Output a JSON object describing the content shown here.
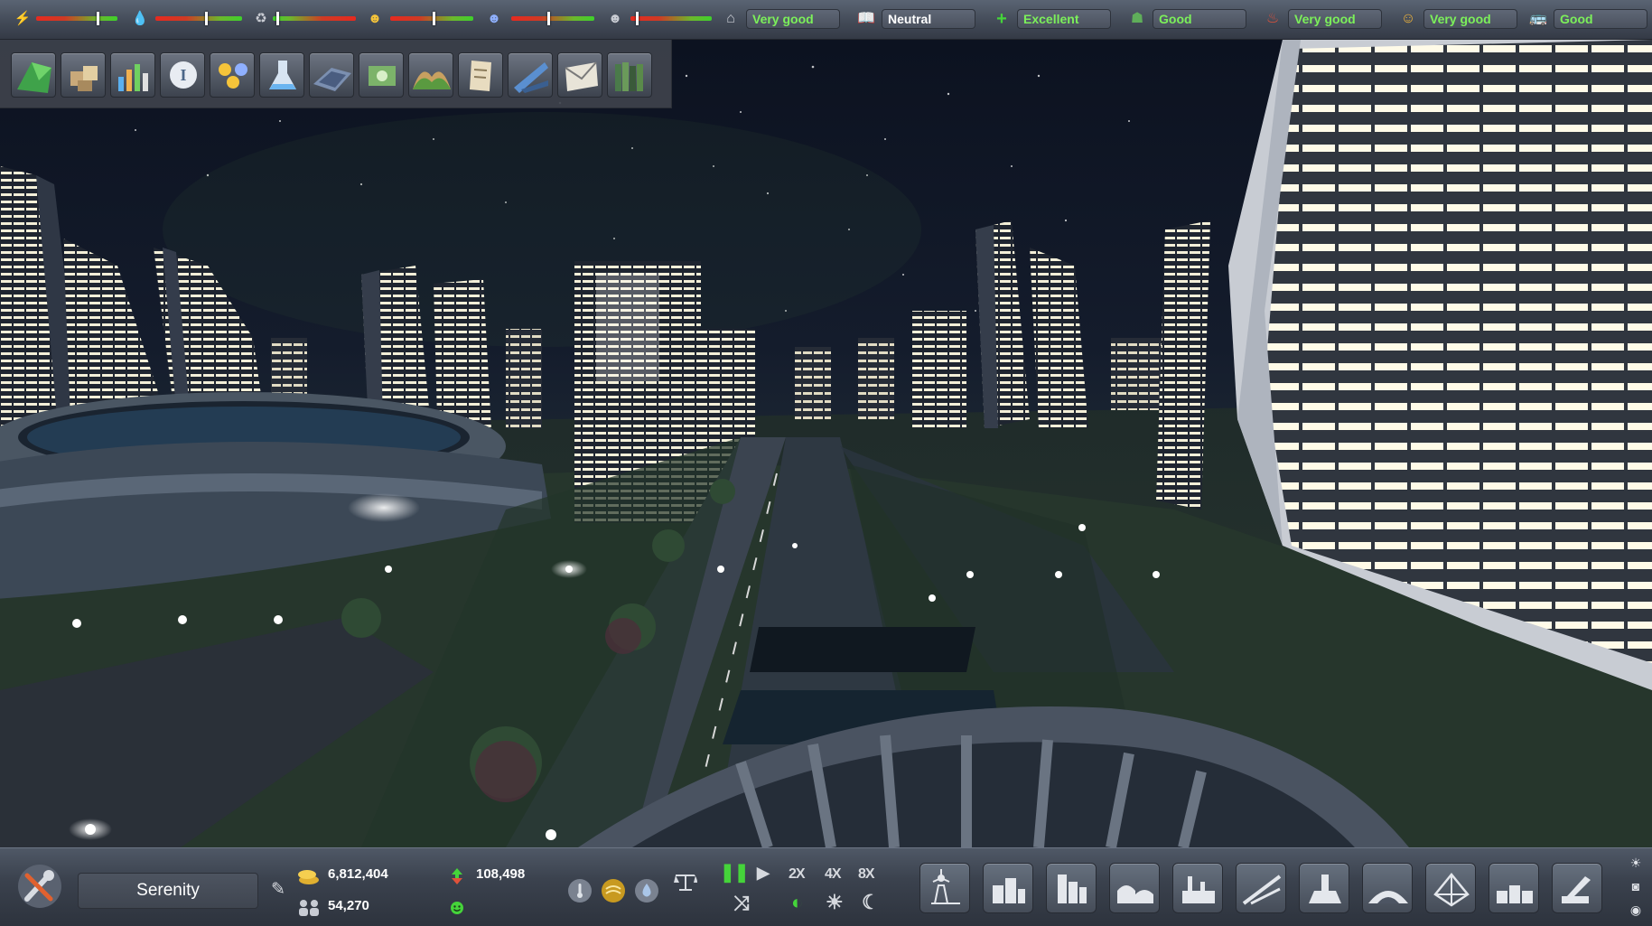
{
  "top_meters": [
    {
      "icon": "power-icon",
      "level": 0.75
    },
    {
      "icon": "water-icon",
      "level": 0.58
    },
    {
      "icon": "waste-icon",
      "level": 0.05
    },
    {
      "icon": "worker-icon",
      "level": 0.52
    },
    {
      "icon": "specialist-icon",
      "level": 0.45
    },
    {
      "icon": "engineer-icon",
      "level": 0.08
    }
  ],
  "ratings": {
    "housing": {
      "icon": "housing-icon",
      "value": "Very good"
    },
    "education": {
      "icon": "education-icon",
      "value": "Neutral"
    },
    "health": {
      "icon": "health-icon",
      "value": "Excellent"
    },
    "safety": {
      "icon": "safety-icon",
      "value": "Good"
    },
    "fire": {
      "icon": "fire-icon",
      "value": "Very good"
    },
    "leisure": {
      "icon": "leisure-icon",
      "value": "Very good"
    },
    "transport": {
      "icon": "transport-icon",
      "value": "Good"
    }
  },
  "category_toolbar": [
    {
      "icon": "map-overview-icon"
    },
    {
      "icon": "resources-icon"
    },
    {
      "icon": "statistics-icon"
    },
    {
      "icon": "info-icon"
    },
    {
      "icon": "population-icon"
    },
    {
      "icon": "research-icon"
    },
    {
      "icon": "projects-icon"
    },
    {
      "icon": "finance-icon"
    },
    {
      "icon": "environment-icon"
    },
    {
      "icon": "policies-icon"
    },
    {
      "icon": "trade-icon"
    },
    {
      "icon": "mail-icon"
    },
    {
      "icon": "library-icon"
    }
  ],
  "bottom": {
    "city_name": "Serenity",
    "money": "6,812,404",
    "population": "54,270",
    "income": "108,498",
    "speeds": {
      "x2": "2X",
      "x4": "4X",
      "x8": "8X"
    }
  },
  "build_menu": [
    {
      "icon": "power-build-icon"
    },
    {
      "icon": "residential-build-icon"
    },
    {
      "icon": "commercial-build-icon"
    },
    {
      "icon": "services-build-icon"
    },
    {
      "icon": "industry-build-icon"
    },
    {
      "icon": "transport-build-icon"
    },
    {
      "icon": "landmark-build-icon"
    },
    {
      "icon": "leisure-build-icon"
    },
    {
      "icon": "dome-build-icon"
    },
    {
      "icon": "storage-build-icon"
    },
    {
      "icon": "bulldoze-build-icon"
    }
  ],
  "colors": {
    "good": "#7cf05a",
    "neutral": "#ffffff",
    "accent_green": "#45d43a"
  }
}
